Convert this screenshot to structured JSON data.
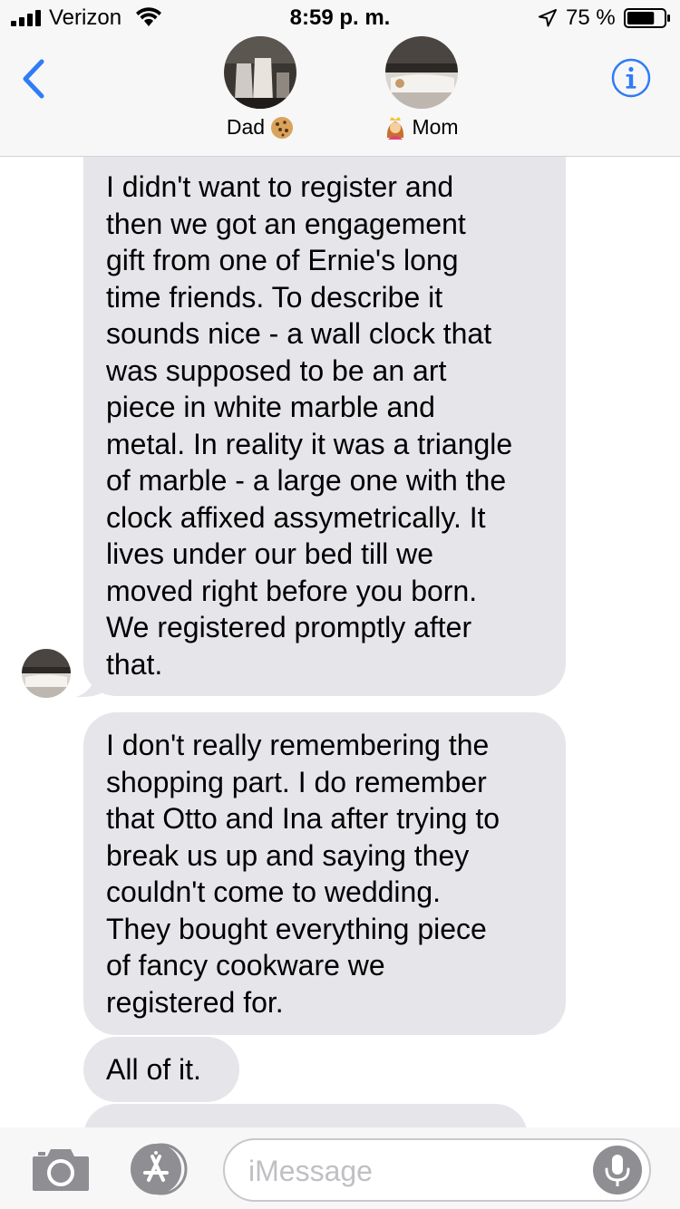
{
  "status_bar": {
    "carrier": "Verizon",
    "time": "8:59 p. m.",
    "battery_percent": "75 %",
    "battery_level": 0.75
  },
  "header": {
    "back_icon": "chevron-left-icon",
    "info_icon": "info-icon",
    "contacts": [
      {
        "name": "Dad",
        "emoji": "🍪"
      },
      {
        "name": "Mom",
        "emoji": "👸"
      }
    ],
    "accent_color": "#2f7cf6"
  },
  "messages": [
    {
      "direction": "incoming",
      "text": "I didn't want to register and\nthen we got an engagement\ngift from one of Ernie's long\ntime friends. To describe it\nsounds nice - a wall clock that\nwas supposed to be an art\npiece in white marble and\nmetal. In reality it was a triangle\nof marble - a large one with the\nclock affixed assymetrically. It\nlives under our bed till we\nmoved right before you born.\nWe registered promptly after\nthat."
    },
    {
      "direction": "incoming",
      "text": "I don't really remembering the\nshopping part. I do remember\nthat Otto and Ina after trying to\nbreak us up and saying they\ncouldn't come to wedding.\nThey bought everything piece\nof fancy cookware we\nregistered for."
    },
    {
      "direction": "incoming",
      "text": "All of it."
    },
    {
      "direction": "incoming",
      "text": "",
      "partially_hidden": true
    }
  ],
  "bubble_color": "#e5e5ea",
  "input_bar": {
    "placeholder": "iMessage",
    "camera_icon": "camera-icon",
    "appstore_icon": "app-store-icon",
    "mic_icon": "microphone-icon"
  }
}
